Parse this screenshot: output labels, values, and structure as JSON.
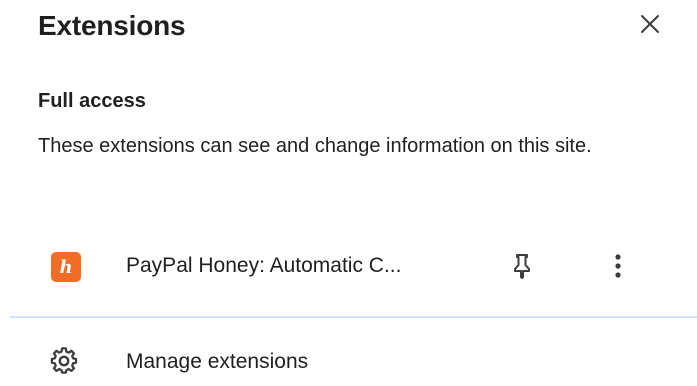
{
  "panel": {
    "title": "Extensions",
    "close_icon": "close-icon"
  },
  "full_access": {
    "heading": "Full access",
    "description": "These extensions can see and change information on this site."
  },
  "extensions": [
    {
      "name": "PayPal Honey: Automatic C...",
      "icon": "honey-logo-icon",
      "icon_letter": "h",
      "icon_color": "#f26c25",
      "pin_icon": "pin-icon",
      "menu_icon": "more-vert-icon"
    }
  ],
  "manage": {
    "label": "Manage extensions",
    "icon": "gear-icon"
  },
  "colors": {
    "text": "#1f1f1f",
    "divider": "#d3e3fd",
    "background": "#ffffff"
  }
}
